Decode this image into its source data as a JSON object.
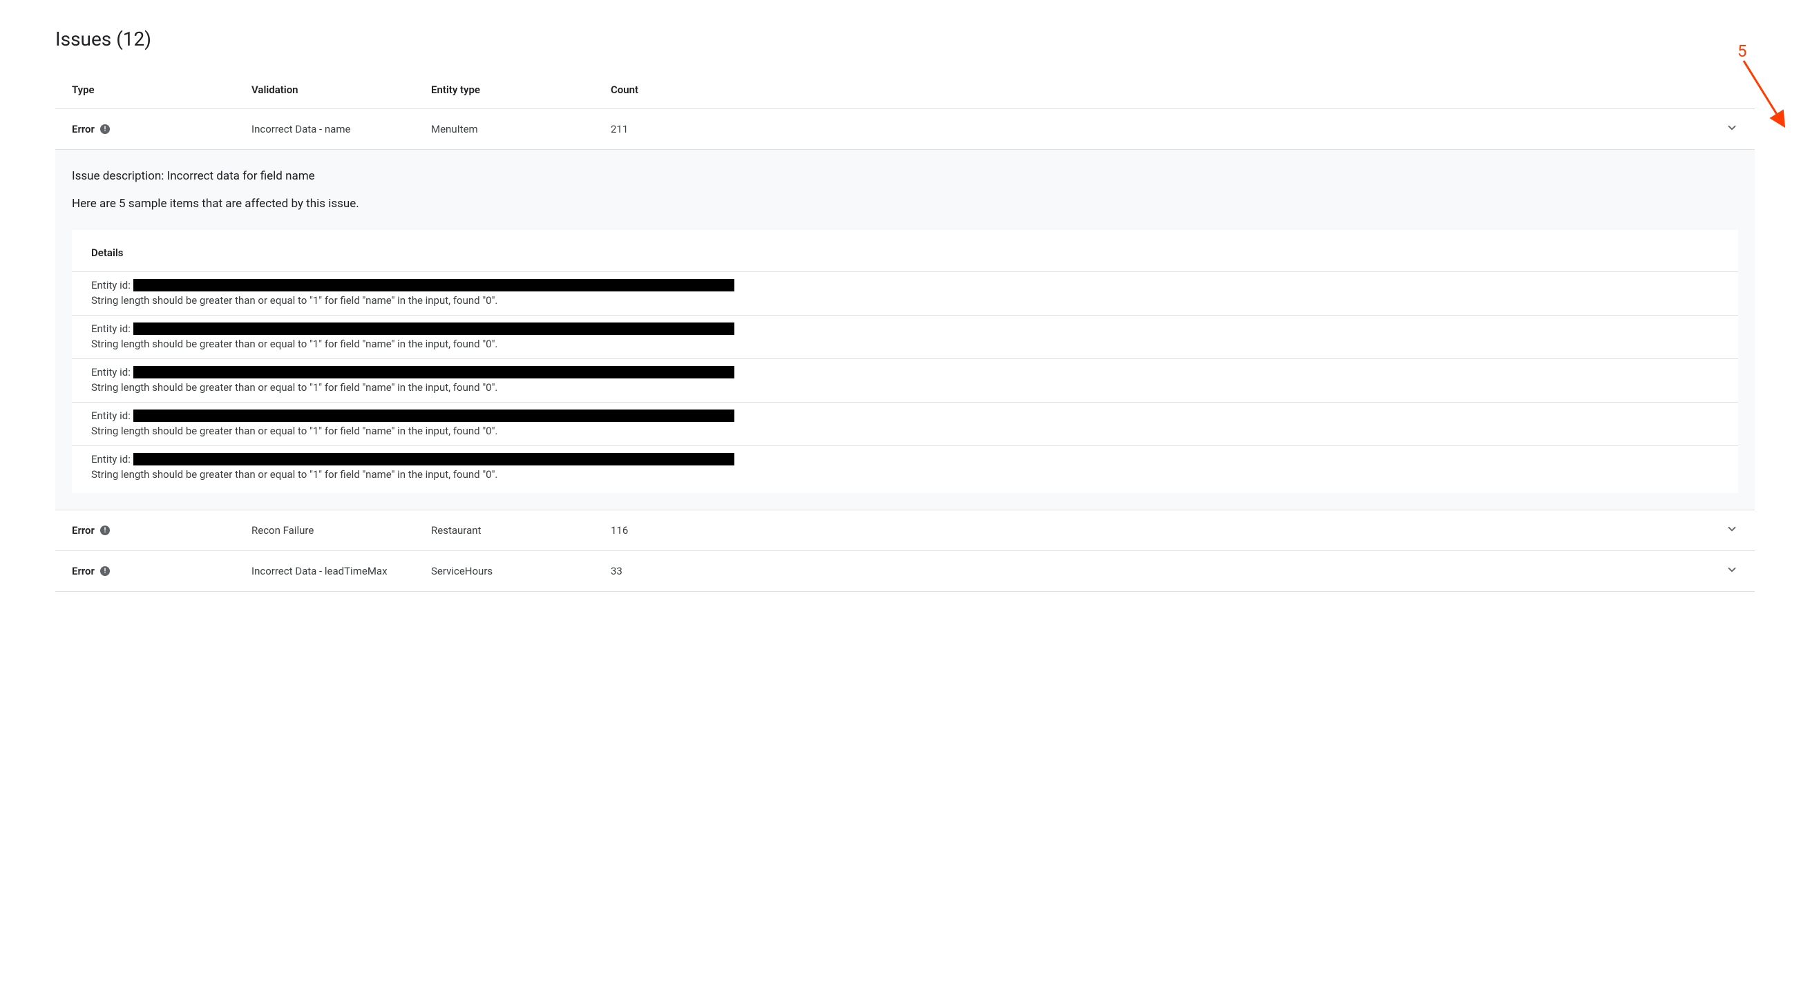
{
  "page": {
    "title": "Issues (12)"
  },
  "columns": {
    "type": "Type",
    "validation": "Validation",
    "entity_type": "Entity type",
    "count": "Count"
  },
  "rows": [
    {
      "type_label": "Error",
      "validation": "Incorrect Data - name",
      "entity_type": "MenuItem",
      "count": "211",
      "expanded": true
    },
    {
      "type_label": "Error",
      "validation": "Recon Failure",
      "entity_type": "Restaurant",
      "count": "116",
      "expanded": false
    },
    {
      "type_label": "Error",
      "validation": "Incorrect Data - leadTimeMax",
      "entity_type": "ServiceHours",
      "count": "33",
      "expanded": false
    }
  ],
  "expanded": {
    "description_label": "Issue description:",
    "description_text": "Incorrect data for field name",
    "sample_text": "Here are 5 sample items that are affected by this issue.",
    "details_title": "Details",
    "entity_id_label": "Entity id:",
    "detail_msg": "String length should be greater than or equal to \"1\" for field \"name\" in the input, found \"0\"."
  },
  "annotation": {
    "number": "5"
  }
}
